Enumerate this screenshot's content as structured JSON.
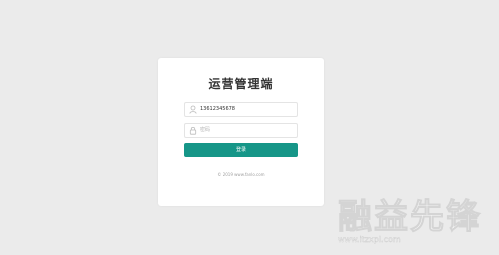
{
  "login": {
    "title": "运营管理端",
    "phone_value": "13612345678",
    "password_placeholder": "密码",
    "submit_label": "登录",
    "copyright": "© 2019 www.fanlo.com"
  },
  "watermark": {
    "main": "融益先锋",
    "sub": "www.itzxpl.com"
  },
  "colors": {
    "background": "#ebebeb",
    "card": "#ffffff",
    "primary": "#169688"
  },
  "icons": [
    "user-icon",
    "lock-icon"
  ]
}
